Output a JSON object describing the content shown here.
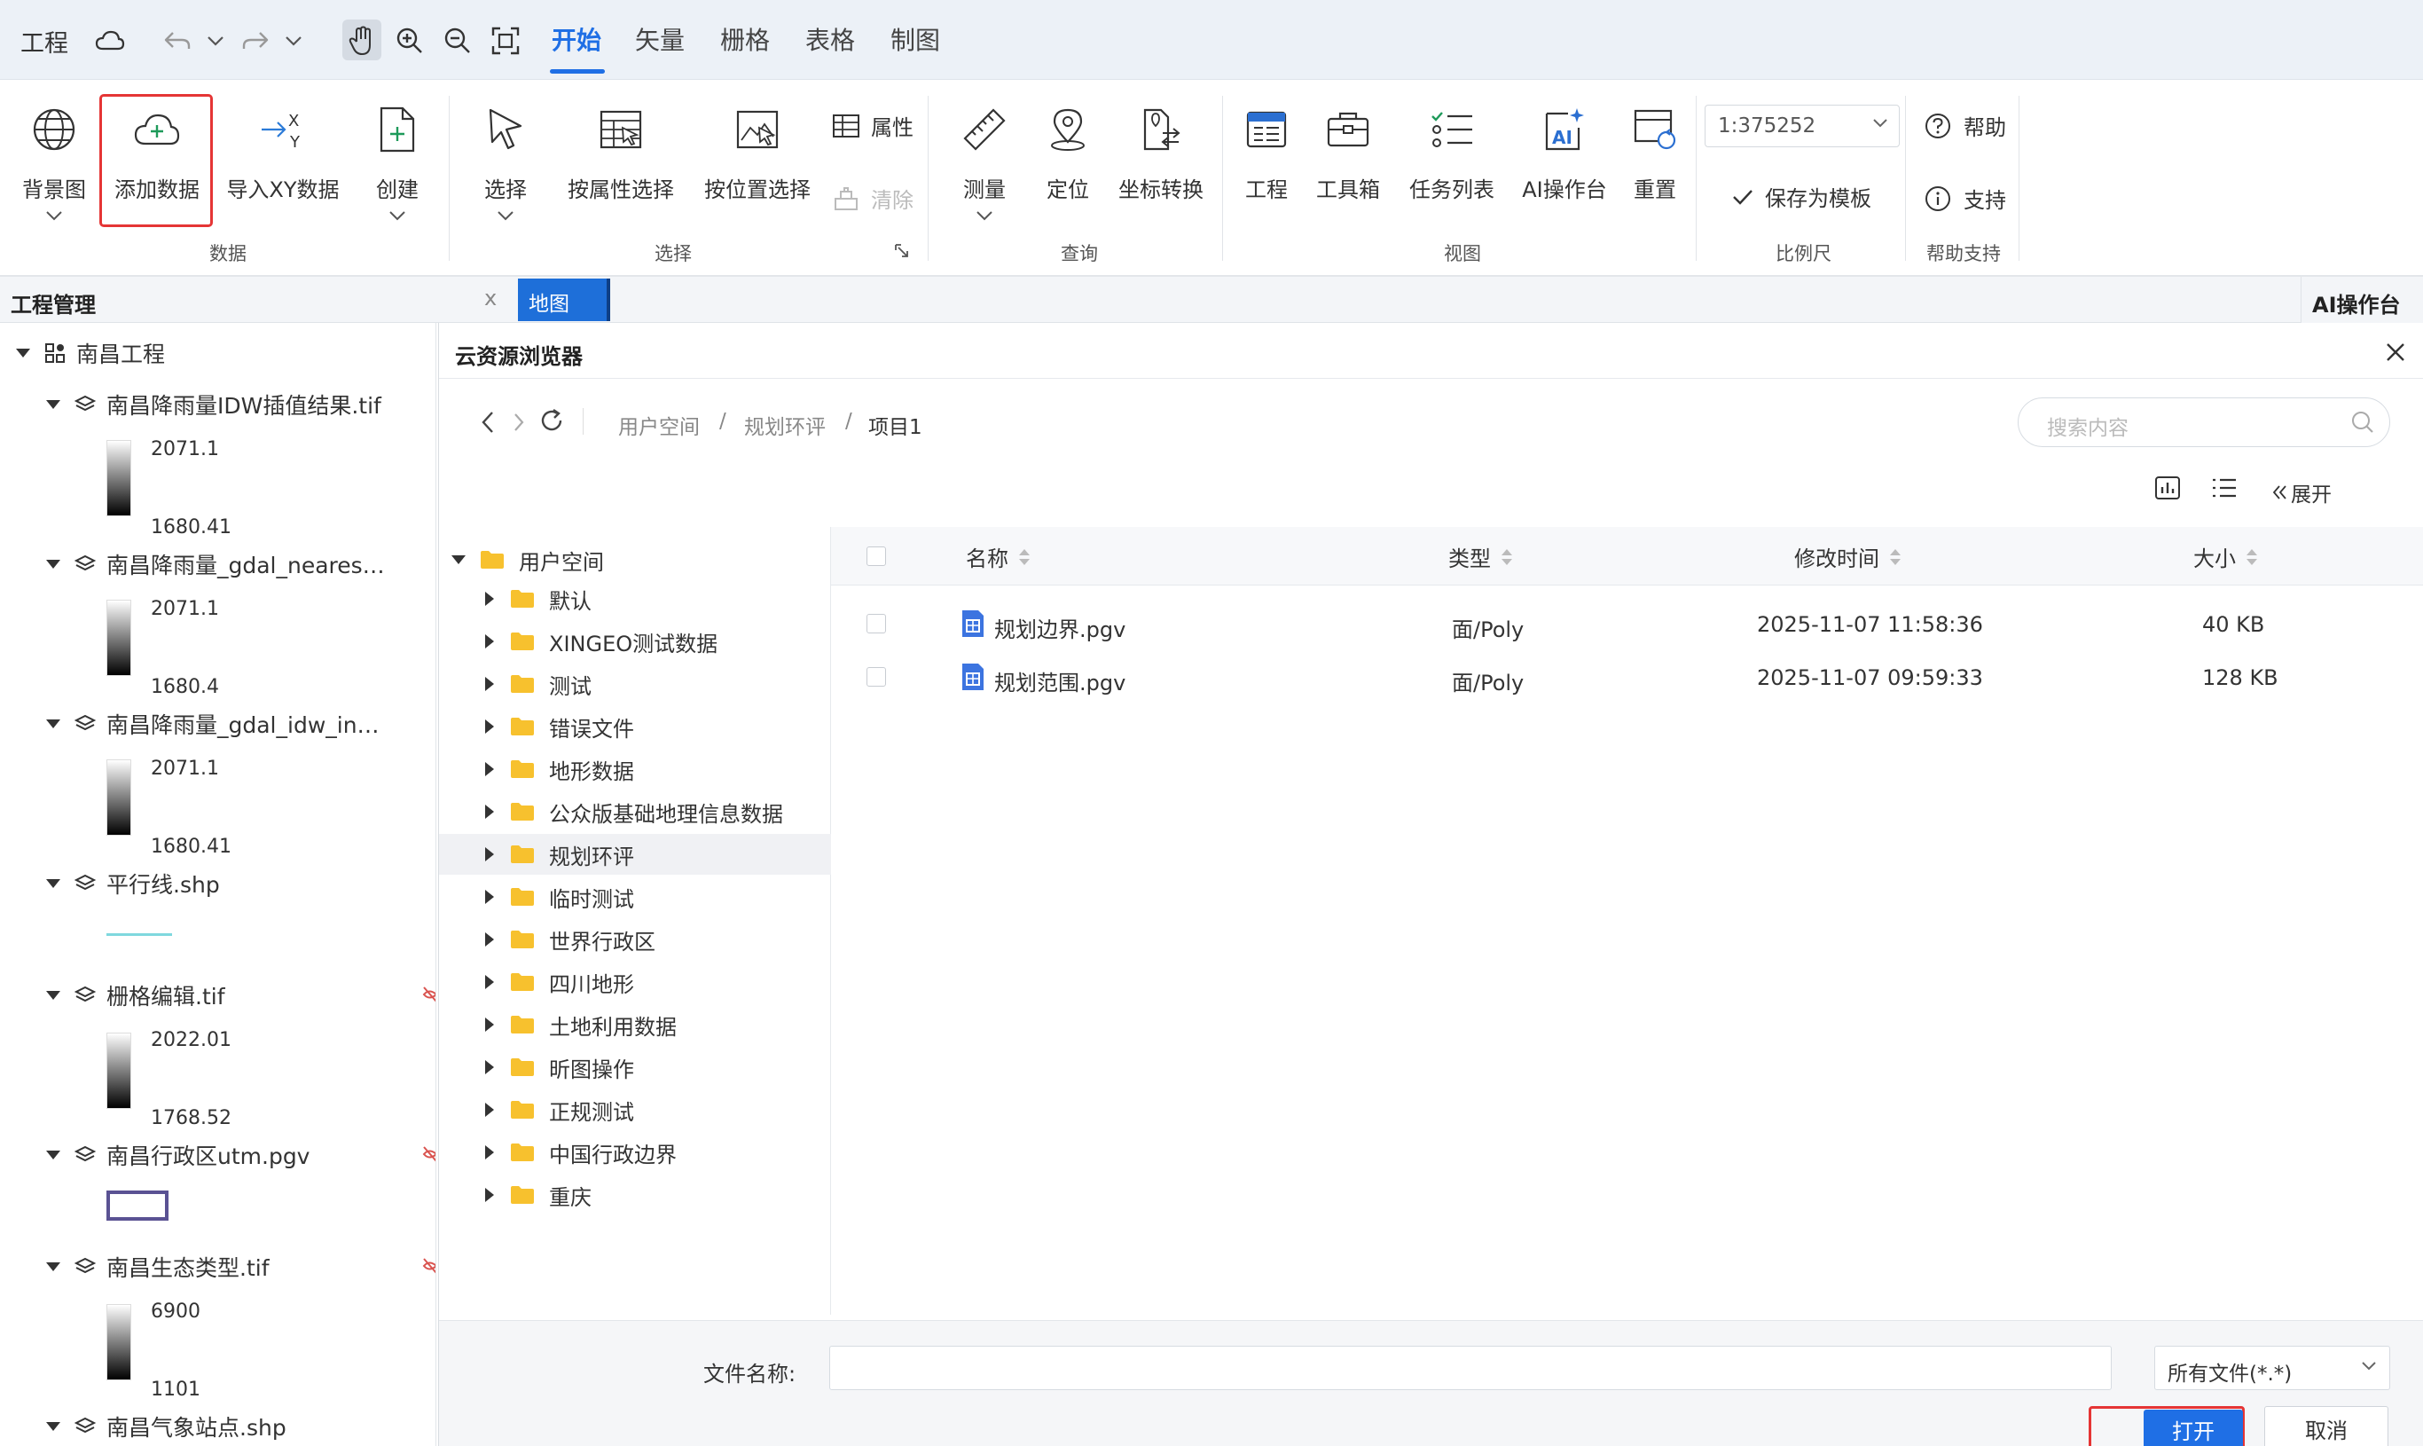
{
  "topbar": {
    "project_label": "工程",
    "tabs": [
      {
        "label": "开始",
        "active": true
      },
      {
        "label": "矢量",
        "active": false
      },
      {
        "label": "栅格",
        "active": false
      },
      {
        "label": "表格",
        "active": false
      },
      {
        "label": "制图",
        "active": false
      }
    ],
    "accent_color": "#1f6fe5"
  },
  "ribbon": {
    "data_group": {
      "label": "数据",
      "basemap": "背景图",
      "add_data": "添加数据",
      "import_xy": "导入XY数据",
      "create": "创建"
    },
    "select_group": {
      "label": "选择",
      "select": "选择",
      "select_by_attr": "按属性选择",
      "select_by_loc": "按位置选择",
      "attributes": "属性",
      "clear": "清除"
    },
    "query_group": {
      "label": "查询",
      "measure": "测量",
      "locate": "定位",
      "coord_convert": "坐标转换"
    },
    "view_group": {
      "label": "视图",
      "project": "工程",
      "toolbox": "工具箱",
      "task_list": "任务列表",
      "ai_console": "AI操作台",
      "reset": "重置"
    },
    "scale_group": {
      "label": "比例尺",
      "scale_value": "1:375252",
      "save_template": "保存为模板"
    },
    "help_group": {
      "label": "帮助支持",
      "help": "帮助",
      "support": "支持"
    }
  },
  "panels": {
    "project_manager": "工程管理",
    "close_x": "x",
    "map_tab": "地图",
    "ai_panel": "AI操作台"
  },
  "project_tree": {
    "root": "南昌工程",
    "layers": [
      {
        "name": "南昌降雨量IDW插值结果.tif",
        "max": "2071.1",
        "min": "1680.41"
      },
      {
        "name": "南昌降雨量_gdal_neares…",
        "max": "2071.1",
        "min": "1680.4"
      },
      {
        "name": "南昌降雨量_gdal_idw_in…",
        "max": "2071.1",
        "min": "1680.41"
      },
      {
        "name": "平行线.shp"
      },
      {
        "name": "栅格编辑.tif",
        "max": "2022.01",
        "min": "1768.52"
      },
      {
        "name": "南昌行政区utm.pgv"
      },
      {
        "name": "南昌生态类型.tif",
        "max": "6900",
        "min": "1101"
      },
      {
        "name": "南昌气象站点.shp"
      }
    ]
  },
  "dialog": {
    "title": "云资源浏览器",
    "breadcrumb": [
      "用户空间",
      "规划环评",
      "项目1"
    ],
    "separator": "/",
    "search_placeholder": "搜索内容",
    "expand_label": "展开",
    "folder_tree": {
      "root": "用户空间",
      "folders": [
        "默认",
        "XINGEO测试数据",
        "测试",
        "错误文件",
        "地形数据",
        "公众版基础地理信息数据",
        "规划环评",
        "临时测试",
        "世界行政区",
        "四川地形",
        "土地利用数据",
        "昕图操作",
        "正规测试",
        "中国行政边界",
        "重庆"
      ],
      "selected": "规划环评"
    },
    "columns": [
      "名称",
      "类型",
      "修改时间",
      "大小"
    ],
    "files": [
      {
        "name": "规划边界.pgv",
        "type": "面/Poly",
        "modified": "2025-11-07 11:58:36",
        "size": "40 KB"
      },
      {
        "name": "规划范围.pgv",
        "type": "面/Poly",
        "modified": "2025-11-07 09:59:33",
        "size": "128 KB"
      }
    ],
    "filename_label": "文件名称:",
    "filename_value": "",
    "filetype": "所有文件(*.*)",
    "open_button": "打开",
    "cancel_button": "取消"
  }
}
